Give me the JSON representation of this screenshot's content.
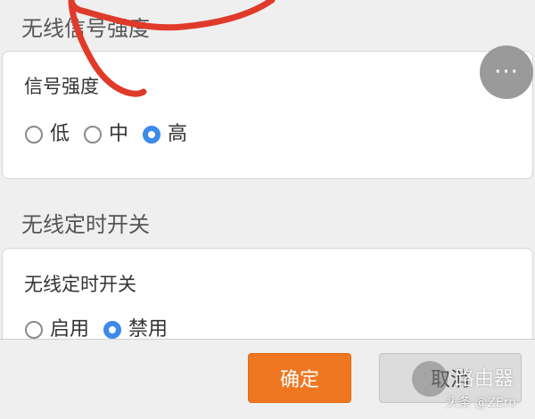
{
  "signal_section": {
    "title": "无线信号强度",
    "field_label": "信号强度",
    "options": [
      {
        "label": "低",
        "selected": false
      },
      {
        "label": "中",
        "selected": false
      },
      {
        "label": "高",
        "selected": true
      }
    ]
  },
  "timer_section": {
    "title": "无线定时开关",
    "field_label": "无线定时开关",
    "options": [
      {
        "label": "启用",
        "selected": false
      },
      {
        "label": "禁用",
        "selected": true
      }
    ]
  },
  "more_button": {
    "glyph": "···",
    "icon": "more-dots-icon"
  },
  "footer": {
    "confirm_label": "确定",
    "cancel_label": "取消"
  },
  "watermark": {
    "brand": "路由器",
    "credit": "头条 @ZEro"
  },
  "colors": {
    "accent": "#3d8be8",
    "confirm_bg": "#f07722",
    "annotation_stroke": "#e03a2a"
  }
}
